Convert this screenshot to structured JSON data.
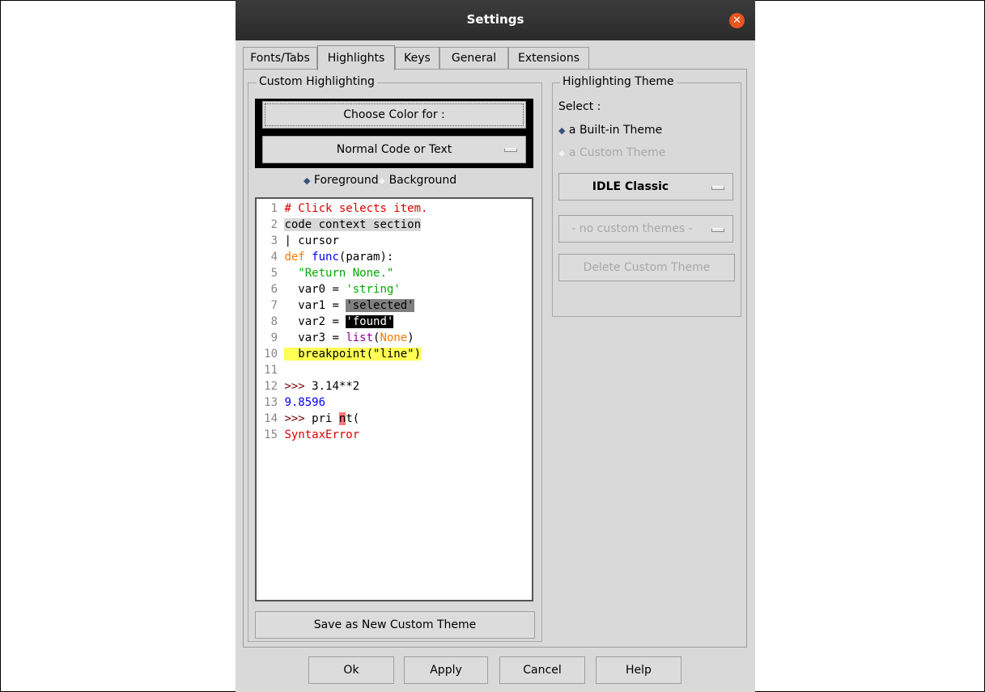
{
  "window": {
    "title": "Settings"
  },
  "tabs": [
    {
      "label": "Fonts/Tabs"
    },
    {
      "label": "Highlights"
    },
    {
      "label": "Keys"
    },
    {
      "label": "General"
    },
    {
      "label": "Extensions"
    }
  ],
  "custom": {
    "group_label": "Custom Highlighting",
    "choose_color_label": "Choose Color for :",
    "element_select_value": "Normal Code or Text",
    "foreground_label": "Foreground",
    "background_label": "Background",
    "save_button_label": "Save as New Custom Theme"
  },
  "theme": {
    "group_label": "Highlighting Theme",
    "select_label": "Select :",
    "builtin_label": "a Built-in Theme",
    "custom_label": "a Custom Theme",
    "builtin_select_value": "IDLE Classic",
    "custom_select_value": "- no custom themes -",
    "delete_button_label": "Delete Custom Theme"
  },
  "sample": {
    "line_numbers": [
      "1",
      "2",
      "3",
      "4",
      "5",
      "6",
      "7",
      "8",
      "9",
      "10",
      "11",
      "12",
      "13",
      "14",
      "15"
    ],
    "l1": "# Click selects item.",
    "l2": "code context section",
    "l3": "| cursor",
    "l4_def": "def",
    "l4_name": "func",
    "l4_rest": "(param):",
    "l5": "\"Return None.\"",
    "l6_a": "var0 = ",
    "l6_b": "'string'",
    "l7_a": "var1 = ",
    "l7_b": "'selected'",
    "l8_a": "var2 = ",
    "l8_b": "'found'",
    "l9_a": "var3 = ",
    "l9_b": "list",
    "l9_c": "(",
    "l9_d": "None",
    "l9_e": ")",
    "l10": "breakpoint(\"line\")",
    "l12_prompt": ">>>",
    "l12_code": " 3.14**2",
    "l13": "9.8596",
    "l14_prompt": ">>>",
    "l14_a": " pri ",
    "l14_b": "n",
    "l14_c": "t(",
    "l15": "SyntaxError"
  },
  "buttons": {
    "ok": "Ok",
    "apply": "Apply",
    "cancel": "Cancel",
    "help": "Help"
  },
  "colors": {
    "titlebar": "#2e2e2e",
    "close": "#e95420",
    "comment": "#dd0000",
    "keyword": "#ff7700",
    "builtin": "#900090",
    "definition": "#0000ff",
    "string": "#00aa00",
    "breakpoint": "#ffff55",
    "error": "#ff7777"
  }
}
